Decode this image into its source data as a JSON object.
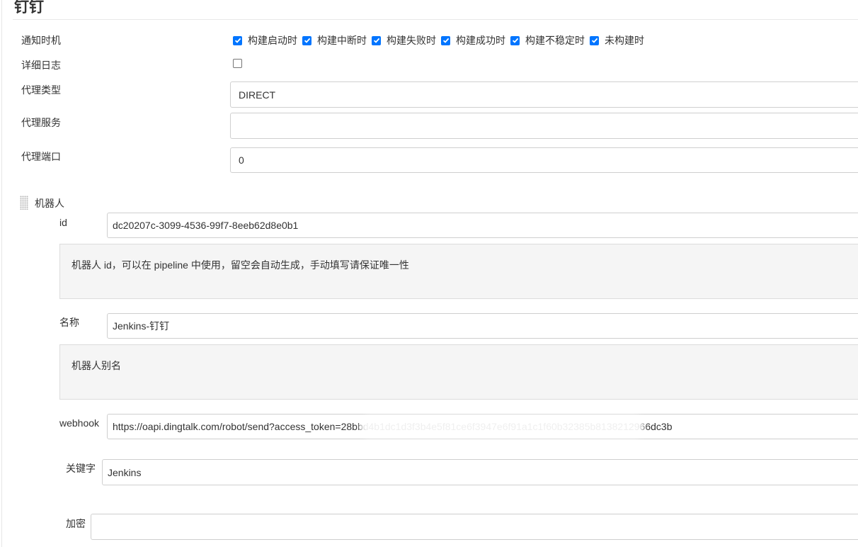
{
  "section": {
    "title": "钉钉"
  },
  "notify": {
    "label": "通知时机",
    "options": [
      {
        "label": "构建启动时",
        "checked": true
      },
      {
        "label": "构建中断时",
        "checked": true
      },
      {
        "label": "构建失败时",
        "checked": true
      },
      {
        "label": "构建成功时",
        "checked": true
      },
      {
        "label": "构建不稳定时",
        "checked": true
      },
      {
        "label": "未构建时",
        "checked": true
      }
    ]
  },
  "verbose_log": {
    "label": "详细日志",
    "checked": false
  },
  "proxy": {
    "type_label": "代理类型",
    "type_value": "DIRECT",
    "server_label": "代理服务",
    "server_value": "",
    "port_label": "代理端口",
    "port_value": "0"
  },
  "robot": {
    "heading": "机器人",
    "id_label": "id",
    "id_value": "dc20207c-3099-4536-99f7-8eeb62d8e0b1",
    "id_help": "机器人 id，可以在 pipeline 中使用，留空会自动生成，手动填写请保证唯一性",
    "name_label": "名称",
    "name_value": "Jenkins-钉钉",
    "name_help": "机器人别名",
    "webhook_label": "webhook",
    "webhook_value": "https://oapi.dingtalk.com/robot/send?access_token=28bbd4b1dc1d3f3b4e5f81ce6f3947e6f91a1c1f60b32385b8138212966dc3b",
    "keyword_label": "关键字",
    "keyword_value": "Jenkins",
    "secret_label": "加密",
    "secret_value": ""
  },
  "colors": {
    "checkbox_accent": "#0075ff",
    "help_bg": "#f5f5f5",
    "border": "#cfcfcf"
  },
  "icons": {
    "check": "checkmark-icon",
    "drag": "drag-handle-icon"
  }
}
